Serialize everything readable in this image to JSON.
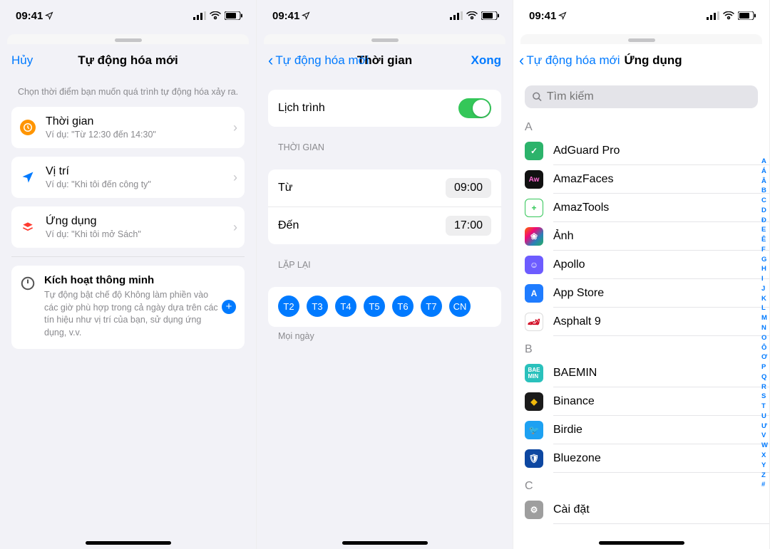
{
  "status": {
    "time": "09:41"
  },
  "screen1": {
    "nav": {
      "cancel": "Hủy",
      "title": "Tự động hóa mới"
    },
    "hint": "Chọn thời điểm bạn muốn quá trình tự động hóa xảy ra.",
    "rows": [
      {
        "title": "Thời gian",
        "sub": "Ví dụ: \"Từ 12:30 đến 14:30\""
      },
      {
        "title": "Vị trí",
        "sub": "Ví dụ: \"Khi tôi đến công ty\""
      },
      {
        "title": "Ứng dụng",
        "sub": "Ví dụ: \"Khi tôi mở Sách\""
      }
    ],
    "smart": {
      "title": "Kích hoạt thông minh",
      "desc": "Tự động bật chế độ Không làm phiền vào các giờ phù hợp trong cả ngày dựa trên các tín hiệu như vị trí của bạn, sử dụng ứng dụng, v.v."
    }
  },
  "screen2": {
    "nav": {
      "back": "Tự động hóa mới",
      "title": "Thời gian",
      "done": "Xong"
    },
    "schedule": {
      "label": "Lịch trình"
    },
    "section_time": "THỜI GIAN",
    "from": {
      "label": "Từ",
      "value": "09:00"
    },
    "to": {
      "label": "Đến",
      "value": "17:00"
    },
    "section_repeat": "LẶP LẠI",
    "days": [
      "T2",
      "T3",
      "T4",
      "T5",
      "T6",
      "T7",
      "CN"
    ],
    "every_day": "Mọi ngày"
  },
  "screen3": {
    "nav": {
      "back": "Tự động hóa mới",
      "title": "Ứng dụng"
    },
    "search_placeholder": "Tìm kiếm",
    "sections": {
      "A": [
        "AdGuard Pro",
        "AmazFaces",
        "AmazTools",
        "Ảnh",
        "Apollo",
        "App Store",
        "Asphalt 9"
      ],
      "B": [
        "BAEMIN",
        "Binance",
        "Birdie",
        "Bluezone"
      ],
      "C": [
        "Cài đặt"
      ]
    },
    "index": [
      "A",
      "Á",
      "Â",
      "B",
      "C",
      "D",
      "Đ",
      "E",
      "Ê",
      "F",
      "G",
      "H",
      "I",
      "J",
      "K",
      "L",
      "M",
      "N",
      "O",
      "Ô",
      "Ơ",
      "P",
      "Q",
      "R",
      "S",
      "T",
      "U",
      "Ư",
      "V",
      "W",
      "X",
      "Y",
      "Z",
      "#"
    ]
  }
}
